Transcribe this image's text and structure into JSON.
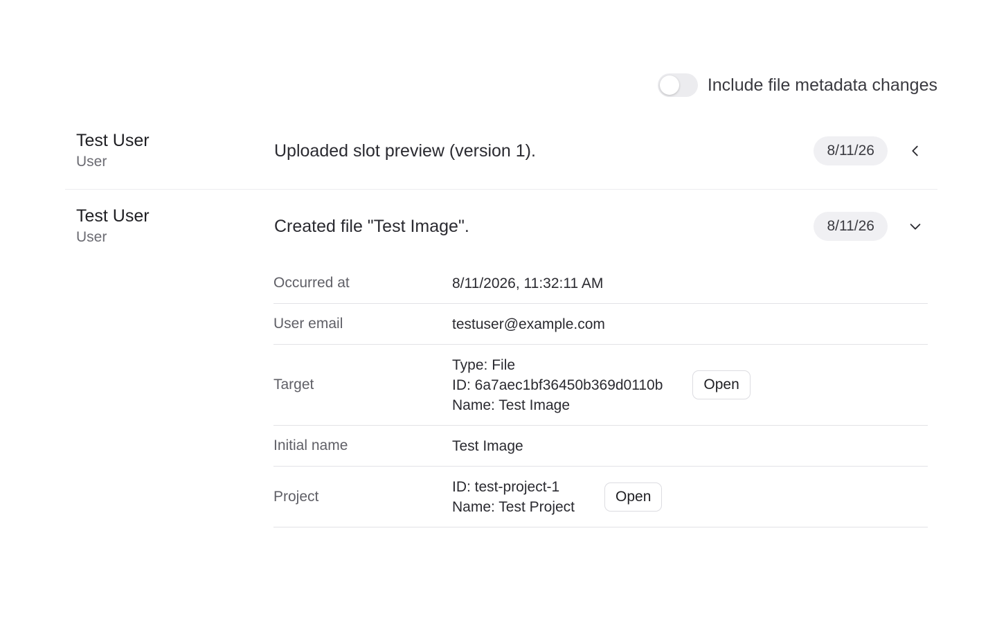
{
  "filters": {
    "metadata_toggle": {
      "label": "Include file metadata changes",
      "on": false
    }
  },
  "activities": [
    {
      "actor_name": "Test User",
      "actor_role": "User",
      "description": "Uploaded slot preview (version 1).",
      "date": "8/11/26",
      "chevron_icon": "chevron-left-icon"
    },
    {
      "actor_name": "Test User",
      "actor_role": "User",
      "description": "Created file \"Test Image\".",
      "date": "8/11/26",
      "chevron_icon": "chevron-down-icon",
      "details": {
        "occurred_at": {
          "label": "Occurred at",
          "value": "8/11/2026, 11:32:11 AM"
        },
        "user_email": {
          "label": "User email",
          "value": "testuser@example.com"
        },
        "target": {
          "label": "Target",
          "type": "Type: File",
          "id": "ID: 6a7aec1bf36450b369d0110b",
          "name": "Name: Test Image",
          "open_label": "Open"
        },
        "initial_name": {
          "label": "Initial name",
          "value": "Test Image"
        },
        "project": {
          "label": "Project",
          "id": "ID: test-project-1",
          "name": "Name: Test Project",
          "open_label": "Open"
        }
      }
    }
  ]
}
